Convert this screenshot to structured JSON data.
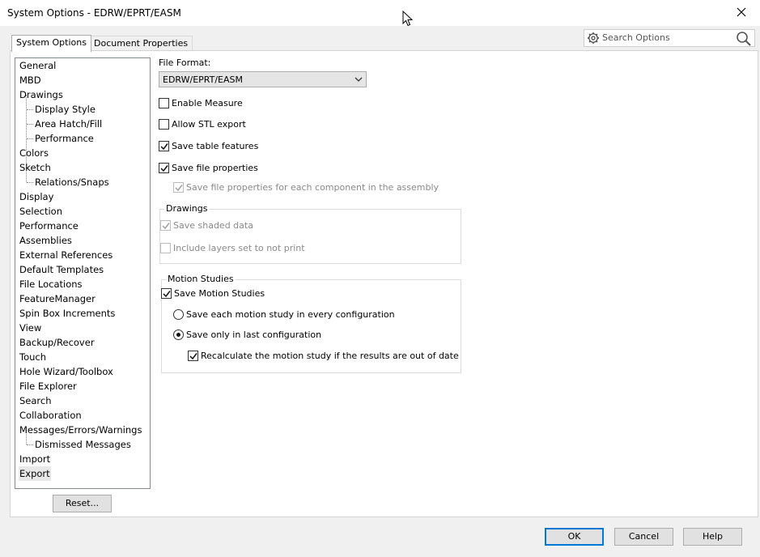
{
  "window": {
    "title": "System Options - EDRW/EPRT/EASM"
  },
  "tabs": [
    {
      "label": "System Options",
      "active": true
    },
    {
      "label": "Document Properties",
      "active": false
    }
  ],
  "search": {
    "placeholder": "Search Options"
  },
  "tree": {
    "items": [
      {
        "label": "General",
        "indent": 0
      },
      {
        "label": "MBD",
        "indent": 0
      },
      {
        "label": "Drawings",
        "indent": 0
      },
      {
        "label": "Display Style",
        "indent": 1
      },
      {
        "label": "Area Hatch/Fill",
        "indent": 1
      },
      {
        "label": "Performance",
        "indent": 1
      },
      {
        "label": "Colors",
        "indent": 0
      },
      {
        "label": "Sketch",
        "indent": 0
      },
      {
        "label": "Relations/Snaps",
        "indent": 1
      },
      {
        "label": "Display",
        "indent": 0
      },
      {
        "label": "Selection",
        "indent": 0
      },
      {
        "label": "Performance",
        "indent": 0
      },
      {
        "label": "Assemblies",
        "indent": 0
      },
      {
        "label": "External References",
        "indent": 0
      },
      {
        "label": "Default Templates",
        "indent": 0
      },
      {
        "label": "File Locations",
        "indent": 0
      },
      {
        "label": "FeatureManager",
        "indent": 0
      },
      {
        "label": "Spin Box Increments",
        "indent": 0
      },
      {
        "label": "View",
        "indent": 0
      },
      {
        "label": "Backup/Recover",
        "indent": 0
      },
      {
        "label": "Touch",
        "indent": 0
      },
      {
        "label": "Hole Wizard/Toolbox",
        "indent": 0
      },
      {
        "label": "File Explorer",
        "indent": 0
      },
      {
        "label": "Search",
        "indent": 0
      },
      {
        "label": "Collaboration",
        "indent": 0
      },
      {
        "label": "Messages/Errors/Warnings",
        "indent": 0
      },
      {
        "label": "Dismissed Messages",
        "indent": 1
      },
      {
        "label": "Import",
        "indent": 0
      },
      {
        "label": "Export",
        "indent": 0,
        "selected": true
      }
    ]
  },
  "reset_label": "Reset...",
  "options": {
    "file_format_label": "File Format:",
    "file_format_value": "EDRW/EPRT/EASM",
    "enable_measure": {
      "label": "Enable Measure",
      "checked": false
    },
    "allow_stl": {
      "label": "Allow STL export",
      "checked": false
    },
    "save_table": {
      "label": "Save table features",
      "checked": true
    },
    "save_file_props": {
      "label": "Save file properties",
      "checked": true
    },
    "save_file_props_each": {
      "label": "Save file properties for each component in the assembly",
      "checked": true,
      "disabled": true
    },
    "drawings_group": {
      "title": "Drawings",
      "save_shaded": {
        "label": "Save shaded data",
        "checked": true,
        "disabled": true
      },
      "include_layers": {
        "label": "Include layers set to not print",
        "checked": false,
        "disabled": true
      }
    },
    "motion_group": {
      "title": "Motion Studies",
      "save_motion": {
        "label": "Save Motion Studies",
        "checked": true
      },
      "save_each": {
        "label": "Save each motion study in every configuration",
        "selected": false
      },
      "save_last": {
        "label": "Save only in last configuration",
        "selected": true
      },
      "recalculate": {
        "label": "Recalculate the motion study if the results are out of date",
        "checked": true
      }
    }
  },
  "footer": {
    "ok": "OK",
    "cancel": "Cancel",
    "help": "Help"
  },
  "colors": {
    "accent": "#0078d7",
    "disabled_text": "#8a8a8a"
  }
}
